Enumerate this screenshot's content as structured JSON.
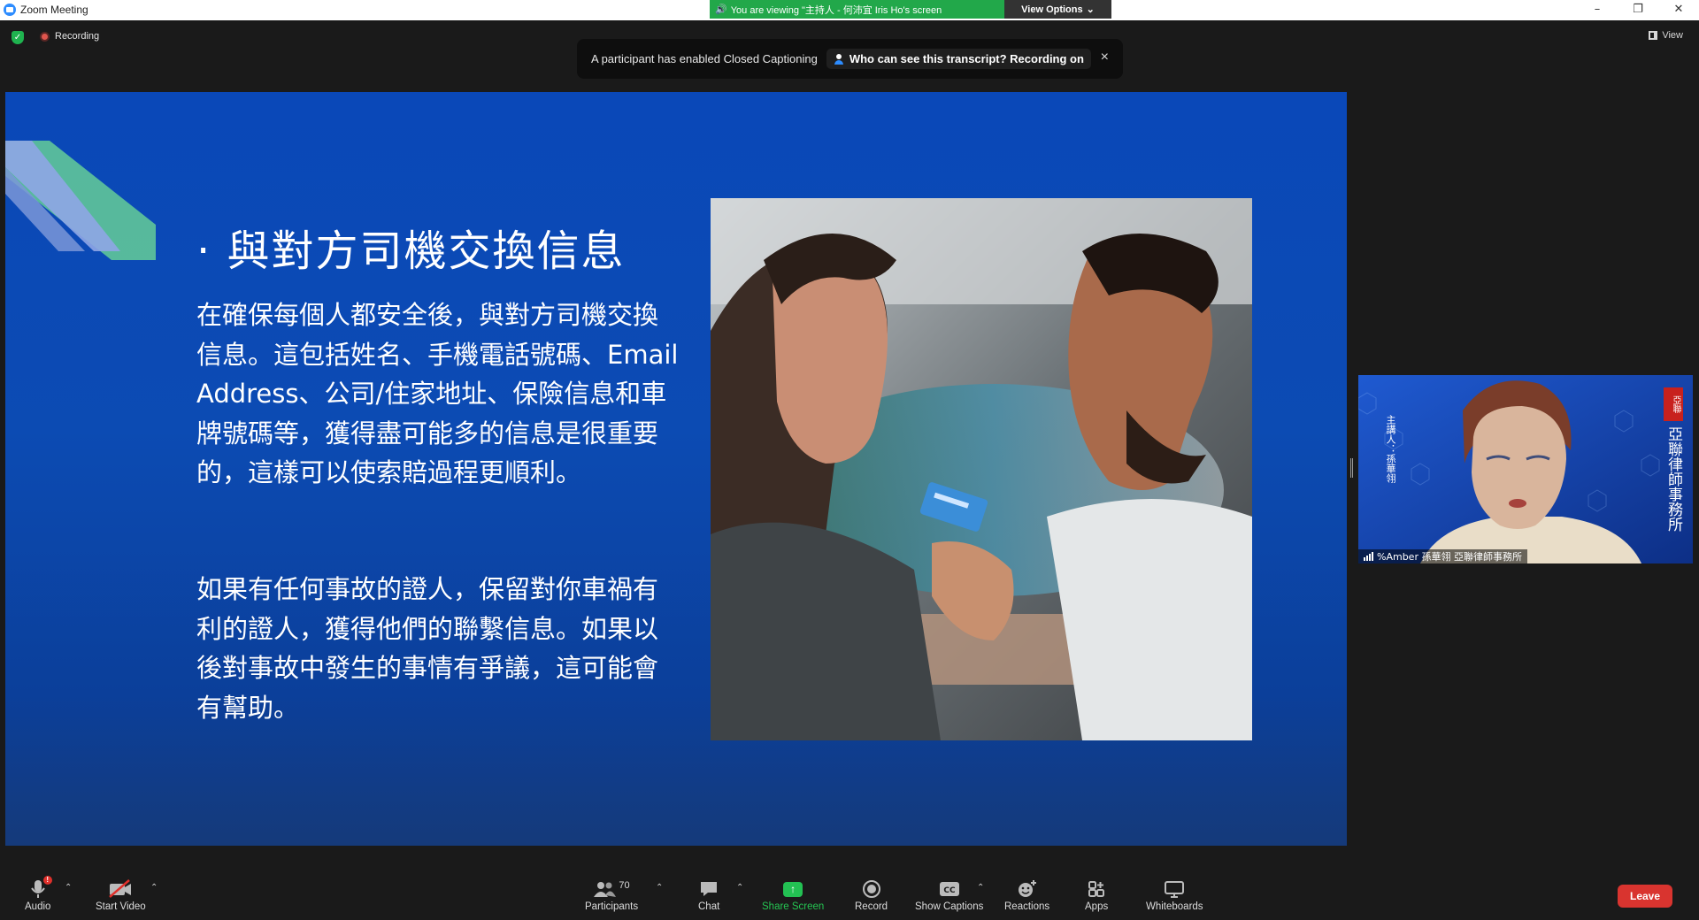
{
  "window": {
    "title": "Zoom Meeting",
    "viewing_banner": "You are viewing \"主持人 - 何沛宜 Iris Ho's screen",
    "view_options": "View Options",
    "controls": [
      "–",
      "❐",
      "✕"
    ]
  },
  "meeting_bar": {
    "recording_label": "Recording",
    "view_label": "View"
  },
  "caption_notice": {
    "message": "A participant has enabled Closed Captioning",
    "who_label": "Who can see this transcript? Recording on",
    "close": "×"
  },
  "slide": {
    "title": "· 與對方司機交換信息",
    "paragraph1": "在確保每個人都安全後，與對方司機交換信息。這包括姓名、手機電話號碼、Email Address、公司/住家地址、保險信息和車牌號碼等，獲得盡可能多的信息是很重要的，這樣可以使索賠過程更順利。",
    "paragraph2": "如果有任何事故的證人，保留對你車禍有利的證人，獲得他們的聯繫信息。如果以後對事故中發生的事情有爭議，這可能會有幫助。"
  },
  "participant_video": {
    "name": "%Amber 孫華翎 亞聯律師事務所",
    "banner_left": "主講人：孫華翎",
    "banner_right": "亞聯律師事務所",
    "seal_text": "亞聯"
  },
  "toolbar": {
    "audio": "Audio",
    "audio_badge": "!",
    "start_video": "Start Video",
    "participants": "Participants",
    "participants_count": "70",
    "chat": "Chat",
    "share_screen": "Share Screen",
    "record": "Record",
    "show_captions": "Show Captions",
    "reactions": "Reactions",
    "apps": "Apps",
    "whiteboards": "Whiteboards",
    "leave": "Leave"
  },
  "colors": {
    "accent_blue": "#2D8CFF",
    "share_green": "#23C153",
    "leave_red": "#D9342F",
    "slide_blue": "#0B48B5"
  }
}
